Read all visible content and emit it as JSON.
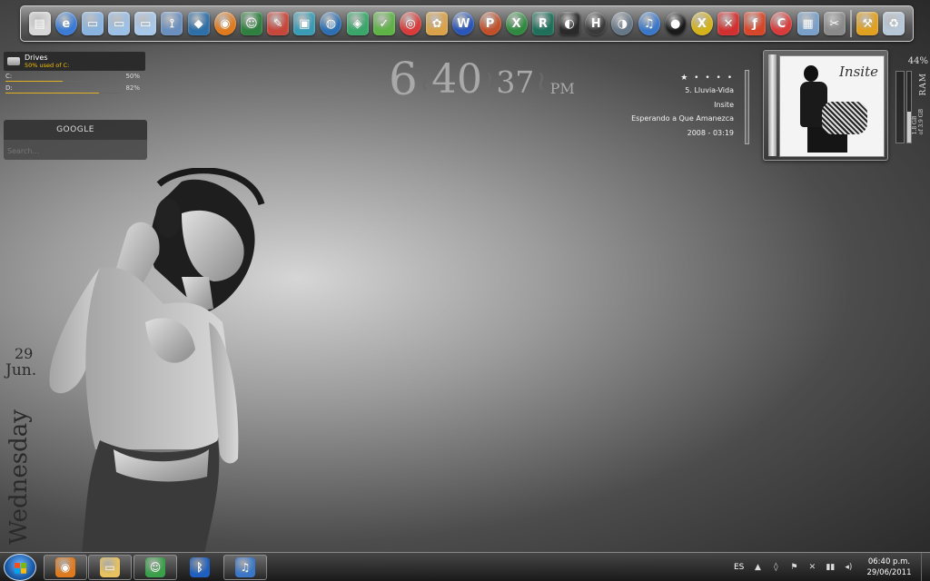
{
  "dock": {
    "items": [
      {
        "name": "computer",
        "bg": "#d7d7d7",
        "glyph": "▤"
      },
      {
        "name": "ie",
        "bg": "#3a7bd5",
        "glyph": "e"
      },
      {
        "name": "folder-docs",
        "bg": "#8ab4e0",
        "glyph": "▭"
      },
      {
        "name": "folder",
        "bg": "#9cc0e6",
        "glyph": "▭"
      },
      {
        "name": "folder-pics",
        "bg": "#a8c8ea",
        "glyph": "▭"
      },
      {
        "name": "network",
        "bg": "#6a8fbf",
        "glyph": "⟟"
      },
      {
        "name": "cube",
        "bg": "#2f6fa8",
        "glyph": "◆"
      },
      {
        "name": "firefox",
        "bg": "#e07a1e",
        "glyph": "◉"
      },
      {
        "name": "people",
        "bg": "#2f7f3f",
        "glyph": "☺"
      },
      {
        "name": "pencil",
        "bg": "#c6473b",
        "glyph": "✎"
      },
      {
        "name": "display",
        "bg": "#3c9bb4",
        "glyph": "▣"
      },
      {
        "name": "globe",
        "bg": "#2c6fb3",
        "glyph": "◍"
      },
      {
        "name": "gem",
        "bg": "#3aa66a",
        "glyph": "◈"
      },
      {
        "name": "green-app",
        "bg": "#5fb246",
        "glyph": "✓"
      },
      {
        "name": "camera",
        "bg": "#d93a3a",
        "glyph": "◎"
      },
      {
        "name": "paint",
        "bg": "#d9a24a",
        "glyph": "✿"
      },
      {
        "name": "word",
        "bg": "#2a56b8",
        "glyph": "W"
      },
      {
        "name": "powerpoint",
        "bg": "#c0502a",
        "glyph": "P"
      },
      {
        "name": "excel",
        "bg": "#2f8a3f",
        "glyph": "X"
      },
      {
        "name": "r-app",
        "bg": "#1f6f5a",
        "glyph": "R"
      },
      {
        "name": "mouse",
        "bg": "#2a2a2a",
        "glyph": "◐"
      },
      {
        "name": "halo",
        "bg": "#3a3a3a",
        "glyph": "H"
      },
      {
        "name": "headset",
        "bg": "#667788",
        "glyph": "◑"
      },
      {
        "name": "itunes",
        "bg": "#3a77c9",
        "glyph": "♫"
      },
      {
        "name": "media",
        "bg": "#1a1a1a",
        "glyph": "●"
      },
      {
        "name": "xtrem",
        "bg": "#d4b21a",
        "glyph": "X"
      },
      {
        "name": "x-app",
        "bg": "#d23030",
        "glyph": "✕"
      },
      {
        "name": "flash",
        "bg": "#d6462a",
        "glyph": "ƒ"
      },
      {
        "name": "ccleaner",
        "bg": "#d93a3a",
        "glyph": "C"
      },
      {
        "name": "calculator",
        "bg": "#7aa0c8",
        "glyph": "▦"
      },
      {
        "name": "tools",
        "bg": "#8a8a8a",
        "glyph": "✂"
      },
      {
        "name": "settings",
        "bg": "#e0a020",
        "glyph": "⚒"
      },
      {
        "name": "recycle-bin",
        "bg": "#b8c8d8",
        "glyph": "♻"
      }
    ]
  },
  "drives": {
    "title": "Drives",
    "subtitle": "50% used of C:",
    "list": [
      {
        "label": "C:",
        "percent": "50%",
        "used": 0.5
      },
      {
        "label": "D:",
        "percent": "82%",
        "used": 0.82
      }
    ],
    "accent": "#e0b020"
  },
  "google": {
    "title": "GOOGLE",
    "placeholder": "Search..."
  },
  "clock": {
    "hour": "6",
    "minute": "40",
    "second": "37",
    "ampm": "PM"
  },
  "nowplaying": {
    "stars": "★ • • • •",
    "track": "5. Lluvia-Vida",
    "artist": "Insite",
    "album": "Esperando a Que Amanezca",
    "year_time": "2008  -  03:19"
  },
  "cover": {
    "art_text": "Insite"
  },
  "ram": {
    "percent": "44%",
    "label": "RAM",
    "detail": "1.8 GB\nof 3.9 GB",
    "used": 0.44
  },
  "date": {
    "day": "29",
    "month": "Jun.",
    "weekday": "Wednesday"
  },
  "taskbar": {
    "pinned": [
      {
        "name": "firefox",
        "bg": "#e07a1e",
        "glyph": "◉"
      },
      {
        "name": "explorer",
        "bg": "#e8c260",
        "glyph": "▭"
      },
      {
        "name": "messenger",
        "bg": "#3aa04a",
        "glyph": "☺"
      },
      {
        "name": "bluetooth",
        "bg": "#1f5fc0",
        "glyph": "ᛒ"
      },
      {
        "name": "itunes",
        "bg": "#3a77c9",
        "glyph": "♫"
      }
    ],
    "language": "ES",
    "tray_icons": [
      "▲",
      "◊",
      "⚑",
      "✕",
      "▮▮",
      "◂)"
    ],
    "time": "06:40 p.m.",
    "date": "29/06/2011"
  }
}
